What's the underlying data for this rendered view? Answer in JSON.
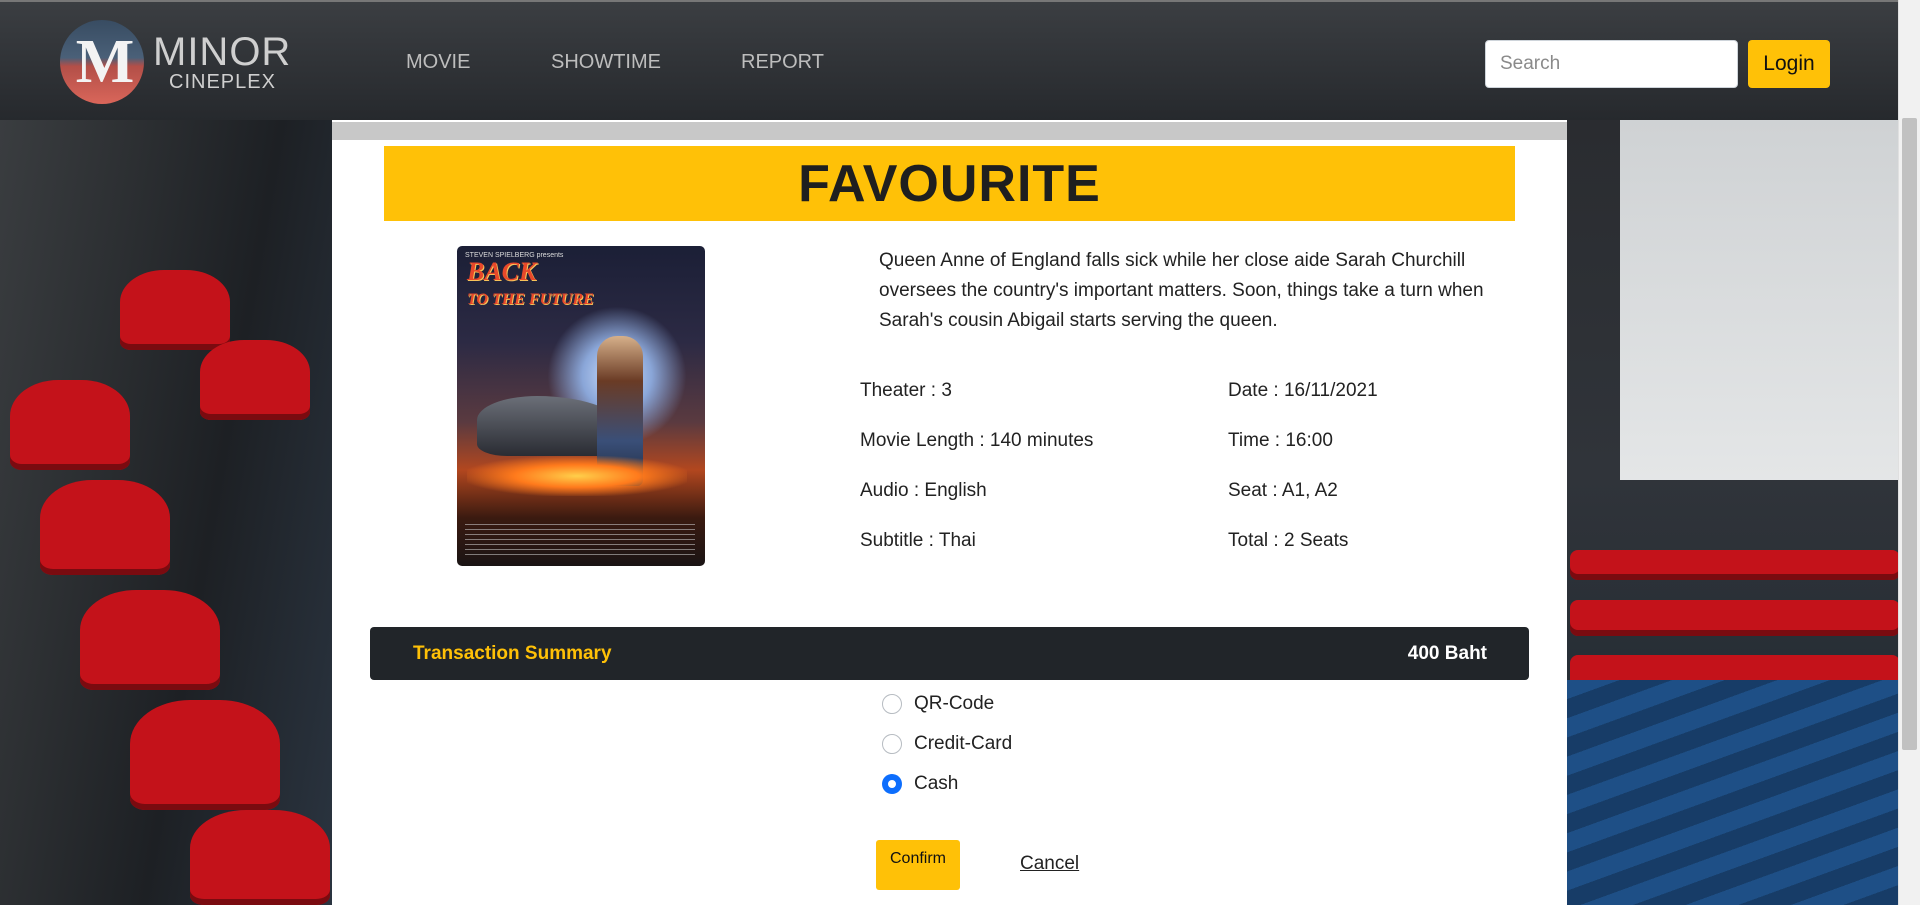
{
  "header": {
    "brand_line1": "MINOR",
    "brand_line2": "CINEPLEX",
    "logo_glyph": "M",
    "nav": [
      {
        "label": "MOVIE"
      },
      {
        "label": "SHOWTIME"
      },
      {
        "label": "REPORT"
      }
    ],
    "search_placeholder": "Search",
    "login_label": "Login"
  },
  "page": {
    "title": "FAVOURITE",
    "description": "Queen Anne of England falls sick while her close aide Sarah Churchill oversees the country's important matters. Soon, things take a turn when Sarah's cousin Abigail starts serving the queen.",
    "poster": {
      "top_line": "STEVEN SPIELBERG presents",
      "title_line1": "BACK",
      "title_line2": "TO THE FUTURE"
    },
    "details": {
      "theater": "Theater : 3",
      "movie_length": "Movie Length : 140 minutes",
      "audio": "Audio : English",
      "subtitle": "Subtitle : Thai",
      "date": "Date : 16/11/2021",
      "time": "Time : 16:00",
      "seat": "Seat : A1, A2",
      "total": "Total : 2 Seats"
    },
    "summary": {
      "label": "Transaction Summary",
      "amount": "400 Baht"
    },
    "payment_options": [
      {
        "label": "QR-Code",
        "checked": false
      },
      {
        "label": "Credit-Card",
        "checked": false
      },
      {
        "label": "Cash",
        "checked": true
      }
    ],
    "confirm_label": "Confirm",
    "cancel_label": "Cancel"
  },
  "colors": {
    "accent": "#ffc107",
    "navbar": "#2b2e32",
    "summary_bar": "#212529",
    "radio_checked": "#0d6efd"
  }
}
